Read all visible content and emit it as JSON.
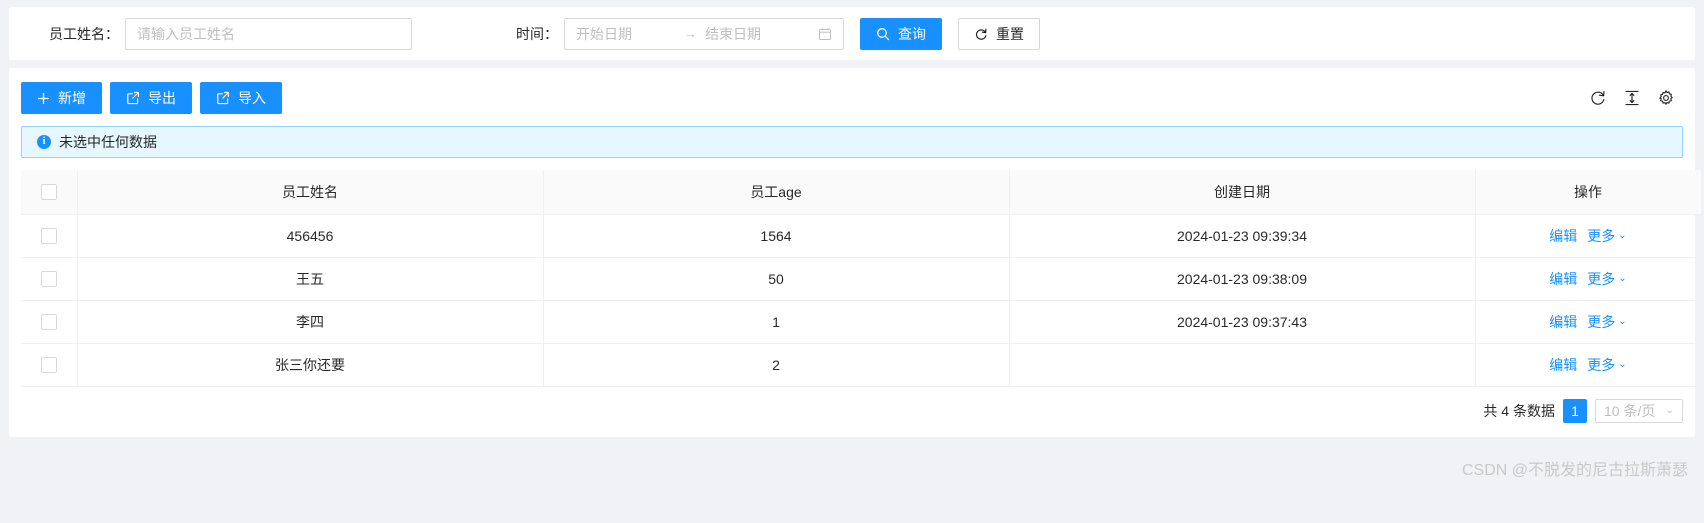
{
  "search": {
    "name_label": "员工姓名：",
    "name_value": "",
    "name_placeholder": "请输入员工姓名",
    "time_label": "时间：",
    "start_value": "",
    "start_placeholder": "开始日期",
    "range_separator": "→",
    "end_value": "",
    "end_placeholder": "结束日期",
    "query_button": "查询",
    "reset_button": "重置",
    "search_icon": "search-icon",
    "reset_icon": "reload-icon",
    "calendar_icon": "calendar-icon"
  },
  "toolbar": {
    "add_button": "新增",
    "export_button": "导出",
    "import_button": "导入",
    "add_icon": "plus-icon",
    "export_icon": "export-icon",
    "import_icon": "import-icon",
    "icons": [
      {
        "name": "reload-icon",
        "title": "刷新"
      },
      {
        "name": "column-height-icon",
        "title": "密度"
      },
      {
        "name": "setting-icon",
        "title": "列设置"
      }
    ]
  },
  "alert": {
    "text": "未选中任何数据",
    "icon": "info-circle-icon"
  },
  "table": {
    "columns": [
      {
        "key": "select",
        "label": ""
      },
      {
        "key": "name",
        "label": "员工姓名"
      },
      {
        "key": "age",
        "label": "员工age"
      },
      {
        "key": "date",
        "label": "创建日期"
      },
      {
        "key": "op",
        "label": "操作"
      }
    ],
    "rows": [
      {
        "name": "456456",
        "age": "1564",
        "date": "2024-01-23 09:39:34"
      },
      {
        "name": "王五",
        "age": "50",
        "date": "2024-01-23 09:38:09"
      },
      {
        "name": "李四",
        "age": "1",
        "date": "2024-01-23 09:37:43"
      },
      {
        "name": "张三你还要",
        "age": "2",
        "date": ""
      }
    ],
    "row_actions": {
      "edit": "编辑",
      "more": "更多",
      "more_caret": "⌄"
    }
  },
  "pagination": {
    "total_text": "共 4 条数据",
    "current_page": "1",
    "page_size": "10 条/页",
    "page_size_caret": "⌄"
  },
  "watermark": {
    "text": "CSDN @不脱发的尼古拉斯萧瑟"
  },
  "colors": {
    "primary": "#1890ff",
    "alert_bg": "#e6f7ff",
    "alert_border": "#91d5ff",
    "header_bg": "#fafafa",
    "page_bg": "#f0f2f5",
    "border": "#f0f0f0"
  }
}
